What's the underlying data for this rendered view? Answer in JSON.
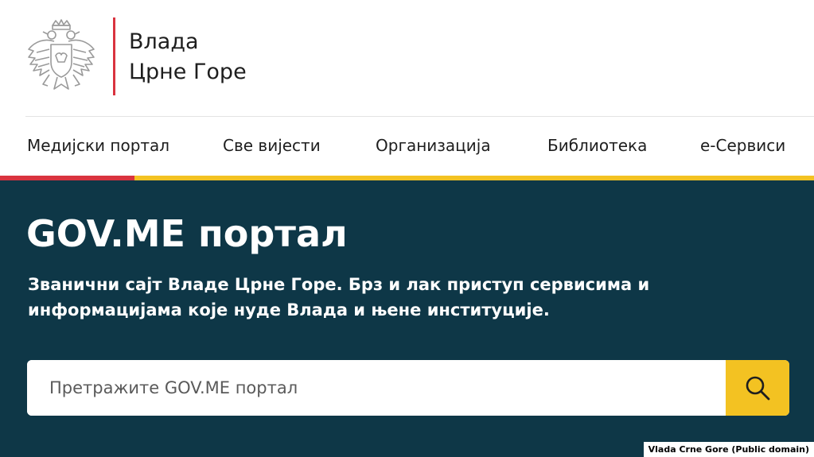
{
  "brand": {
    "line1": "Влада",
    "line2": "Црне Горе"
  },
  "nav": {
    "items": [
      {
        "label": "Медијски портал"
      },
      {
        "label": "Све вијести"
      },
      {
        "label": "Организација"
      },
      {
        "label": "Библиотека"
      },
      {
        "label": "е-Сервиси"
      }
    ]
  },
  "hero": {
    "title": "GOV.ME портал",
    "subtitle": "Званични сајт Владе Црне Горе. Брз и лак приступ сервисима и информацијама које нуде Влада и њене институције."
  },
  "search": {
    "placeholder": "Претражите GOV.ME портал",
    "value": ""
  },
  "credit": "Vlada Crne Gore (Public domain)",
  "icons": {
    "crest": "coat-of-arms-icon",
    "search": "search-icon"
  },
  "colors": {
    "accent_yellow": "#f3c222",
    "accent_red": "#d9333f",
    "hero_bg": "#0e3747"
  }
}
